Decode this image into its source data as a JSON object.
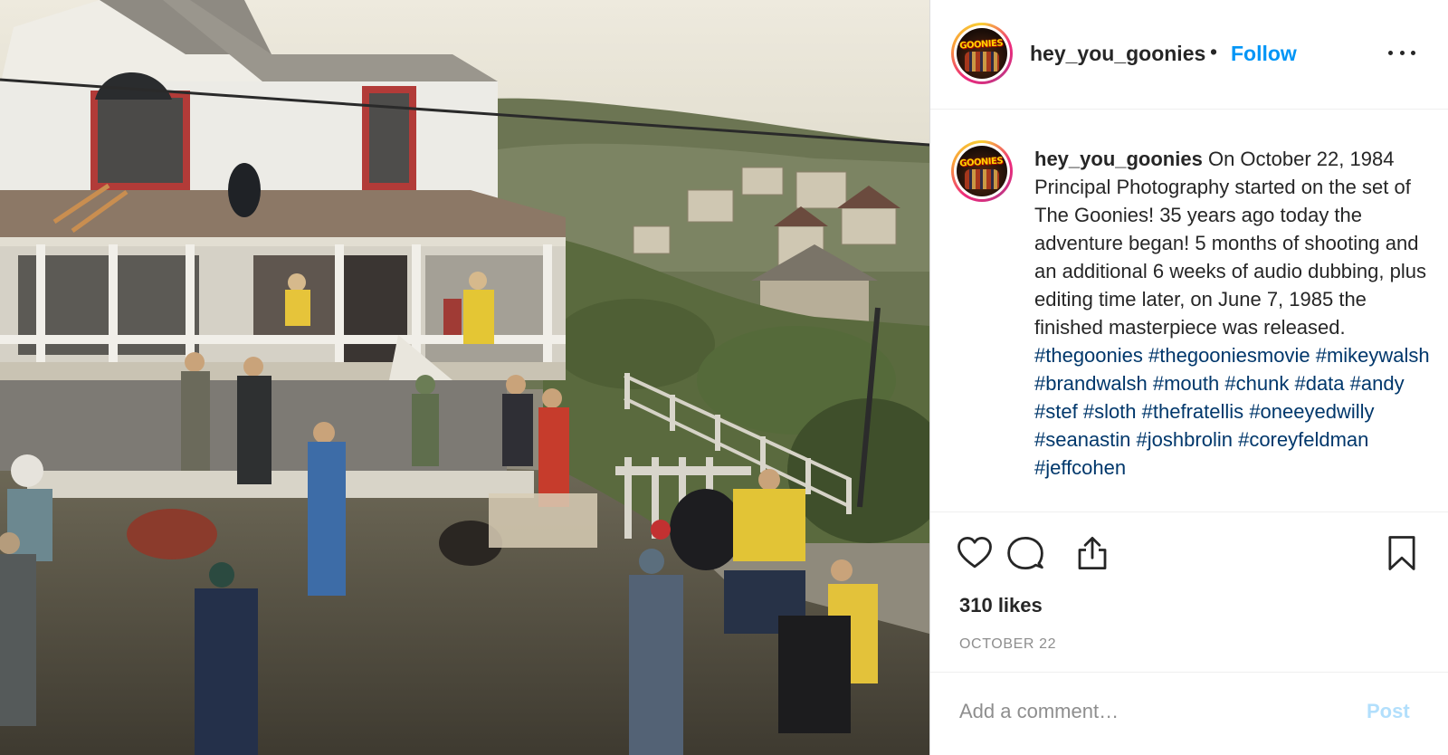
{
  "photo": {
    "alt_icon": "photo-scene"
  },
  "post": {
    "username": "hey_you_goonies",
    "separator": "•",
    "follow_label": "Follow",
    "avatar_logo_text": "GOONIES",
    "caption_text": "On October 22, 1984 Principal Photography started on the set of The Goonies! 35 years ago today the adventure began! 5 months of shooting and an additional 6 weeks of audio dubbing, plus editing time later, on June 7, 1985 the finished masterpiece was released.",
    "hashtags": [
      "#thegoonies",
      "#thegooniesmovie",
      "#mikeywalsh",
      "#brandwalsh",
      "#mouth",
      "#chunk",
      "#data",
      "#andy",
      "#stef",
      "#sloth",
      "#thefratellis",
      "#oneeyedwilly",
      "#seanastin",
      "#joshbrolin",
      "#coreyfeldman",
      "#jeffcohen"
    ],
    "likes": "310 likes",
    "date": "OCTOBER 22",
    "comment_placeholder": "Add a comment…",
    "post_label": "Post"
  },
  "icons": {
    "more": "more-options-icon",
    "like": "heart-icon",
    "comment": "comment-icon",
    "share": "share-icon",
    "save": "bookmark-icon"
  },
  "colors": {
    "follow": "#0095f6",
    "hashtag": "#00376b",
    "post_disabled": "#b2dffc",
    "muted": "#8e8e8e"
  }
}
